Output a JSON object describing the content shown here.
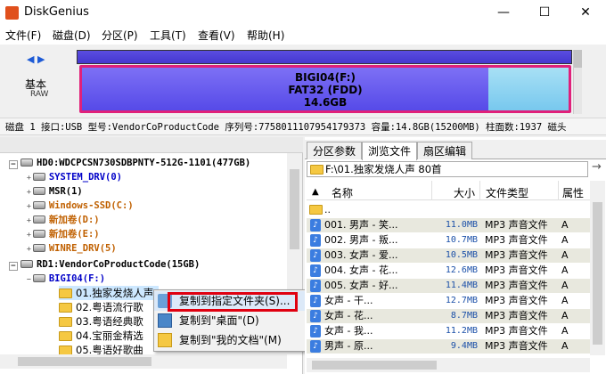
{
  "window": {
    "title": "DiskGenius",
    "minimize": "—",
    "maximize": "☐",
    "close": "✕"
  },
  "menu": [
    "文件(F)",
    "磁盘(D)",
    "分区(P)",
    "工具(T)",
    "查看(V)",
    "帮助(H)"
  ],
  "disk": {
    "label_line1": "基本",
    "label_line2": "RAW",
    "nav": "◀ ▶",
    "partition_name": "BIGI04(F:)",
    "partition_fs": "FAT32 (FDD)",
    "partition_size": "14.6GB"
  },
  "infobar": "磁盘 1 接口:USB  型号:VendorCoProductCode  序列号:7758011107954179373  容量:14.8GB(15200MB)  柱面数:1937  磁头",
  "tree": {
    "rows": [
      {
        "text": "HD0:WDCPCSN730SDBPNTY-512G-1101(477GB)",
        "kind": "disk"
      },
      {
        "text": "SYSTEM_DRV(0)",
        "kind": "part"
      },
      {
        "text": "MSR(1)",
        "kind": "plain"
      },
      {
        "text": "Windows-SSD(C:)",
        "kind": "orange"
      },
      {
        "text": "新加卷(D:)",
        "kind": "orange"
      },
      {
        "text": "新加卷(E:)",
        "kind": "orange"
      },
      {
        "text": "WINRE_DRV(5)",
        "kind": "orange"
      },
      {
        "text": "RD1:VendorCoProductCode(15GB)",
        "kind": "disk"
      },
      {
        "text": "BIGI04(F:)",
        "kind": "part"
      },
      {
        "text": "01.独家发烧人声",
        "kind": "sel"
      },
      {
        "text": "02.粤语流行歌",
        "kind": "folder"
      },
      {
        "text": "03.粤语经典歌",
        "kind": "folder"
      },
      {
        "text": "04.宝丽金精选",
        "kind": "folder"
      },
      {
        "text": "05.粤语好歌曲",
        "kind": "folder"
      }
    ]
  },
  "context_menu": {
    "items": [
      "复制到指定文件夹(S)...",
      "复制到\"桌面\"(D)",
      "复制到\"我的文档\"(M)"
    ]
  },
  "tabs": [
    "分区参数",
    "浏览文件",
    "扇区编辑"
  ],
  "path": "F:\\01.独家发烧人声  80首",
  "columns": {
    "name": "名称",
    "size": "大小",
    "type": "文件类型",
    "attr": "属性"
  },
  "files": [
    {
      "name": "..",
      "size": "",
      "type": "",
      "attr": "",
      "icon": "folder"
    },
    {
      "name": "001. 男声 - 笑...",
      "size": "11.0MB",
      "type": "MP3 声音文件",
      "attr": "A",
      "icon": "music"
    },
    {
      "name": "002. 男声 - 叛...",
      "size": "10.7MB",
      "type": "MP3 声音文件",
      "attr": "A",
      "icon": "music"
    },
    {
      "name": "003. 女声 - 爱...",
      "size": "10.5MB",
      "type": "MP3 声音文件",
      "attr": "A",
      "icon": "music"
    },
    {
      "name": "004. 女声 - 花...",
      "size": "12.6MB",
      "type": "MP3 声音文件",
      "attr": "A",
      "icon": "music"
    },
    {
      "name": "005. 女声 - 好...",
      "size": "11.4MB",
      "type": "MP3 声音文件",
      "attr": "A",
      "icon": "music"
    },
    {
      "name": "女声 - 干...",
      "size": "12.7MB",
      "type": "MP3 声音文件",
      "attr": "A",
      "icon": "music"
    },
    {
      "name": "女声 - 花...",
      "size": "8.7MB",
      "type": "MP3 声音文件",
      "attr": "A",
      "icon": "music"
    },
    {
      "name": "女声 - 我...",
      "size": "11.2MB",
      "type": "MP3 声音文件",
      "attr": "A",
      "icon": "music"
    },
    {
      "name": "男声 - 原...",
      "size": "9.4MB",
      "type": "MP3 声音文件",
      "attr": "A",
      "icon": "music"
    }
  ]
}
